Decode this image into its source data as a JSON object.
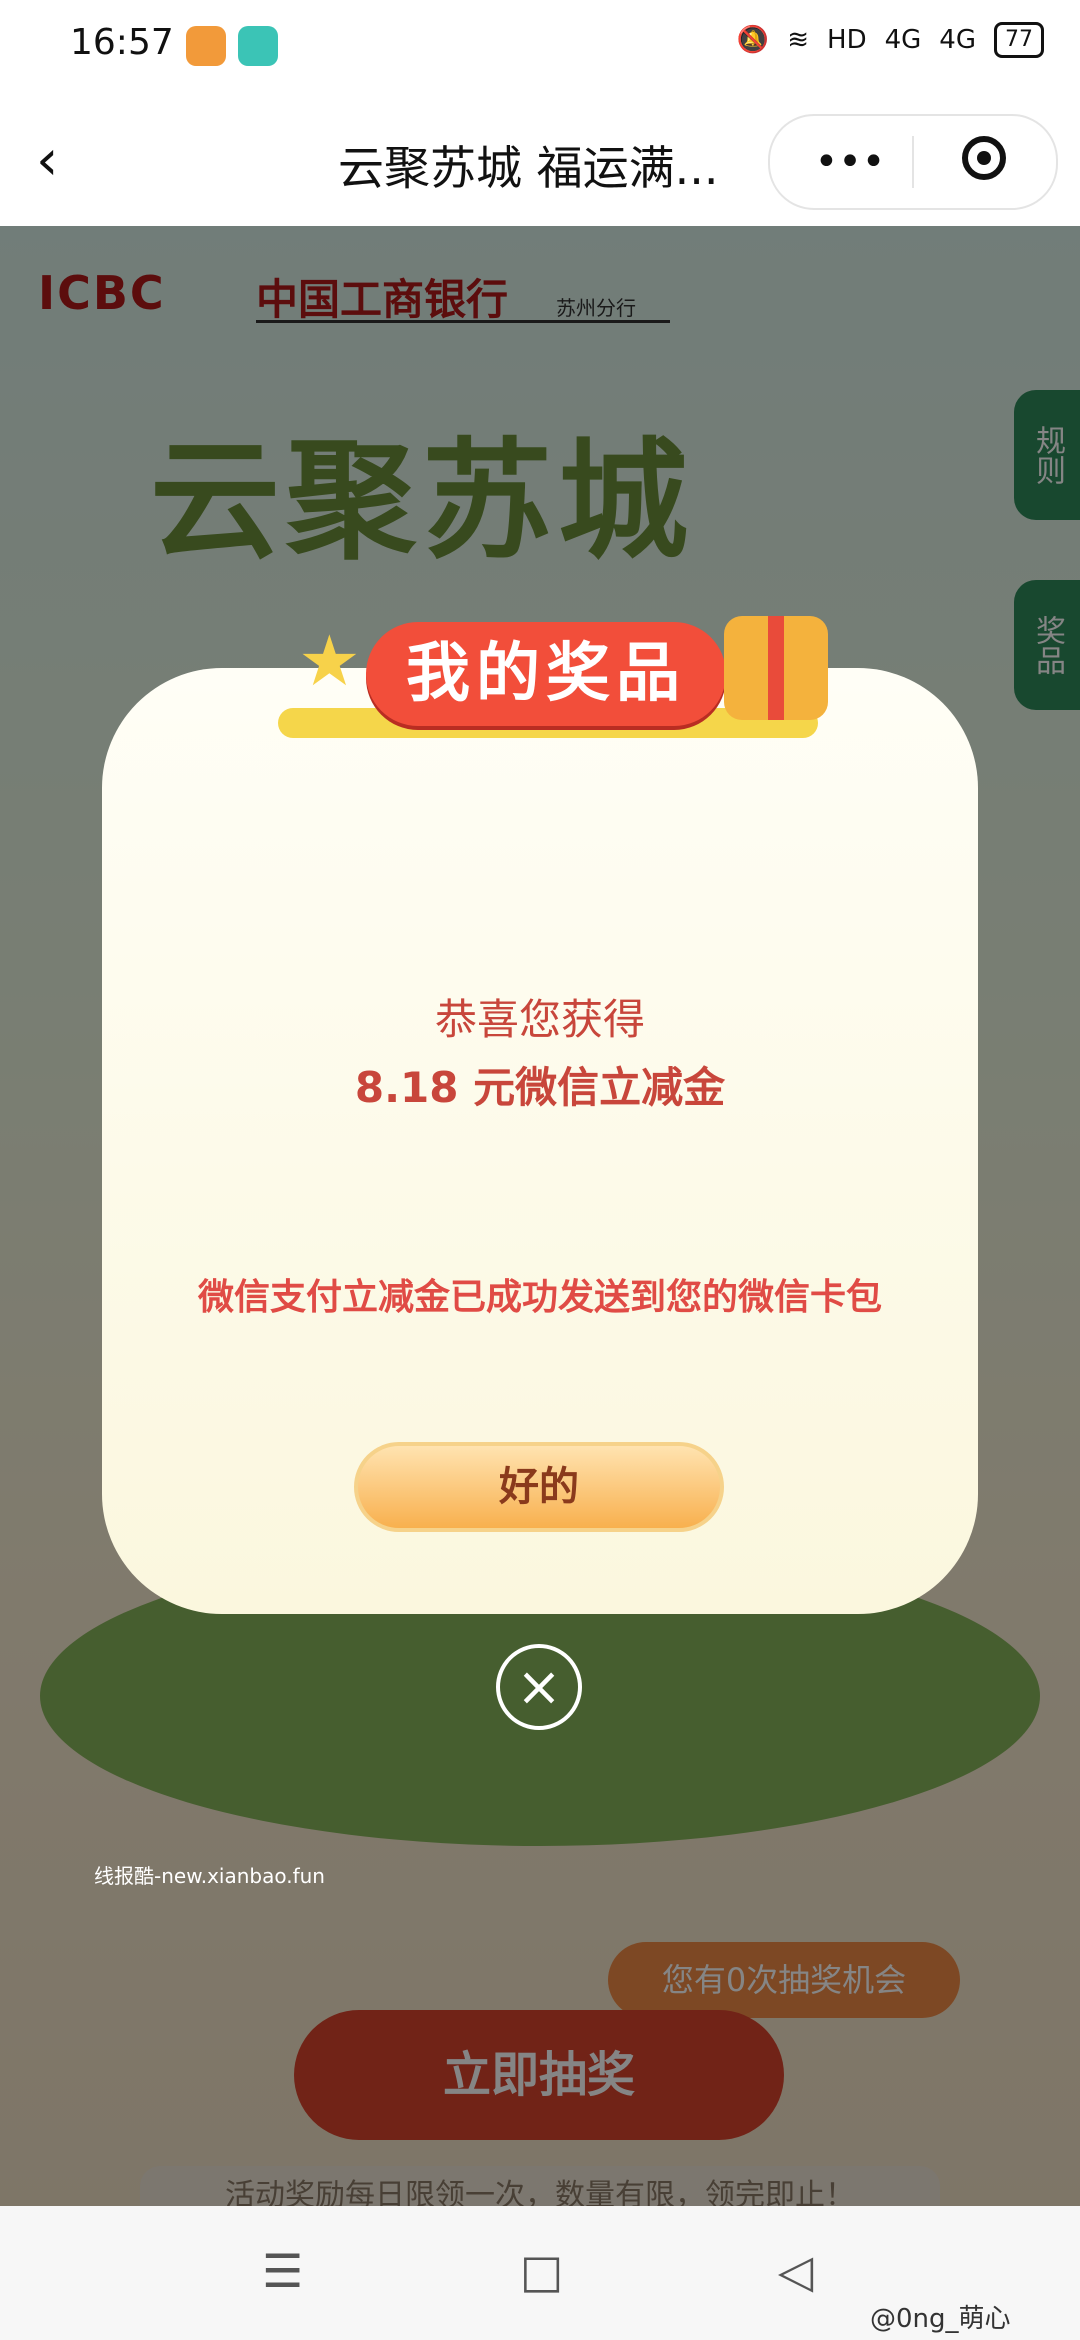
{
  "status_bar": {
    "time": "16:57",
    "network_hd": "HD",
    "signal_1": "4G",
    "signal_2": "4G",
    "battery": "77"
  },
  "title_bar": {
    "back_icon": "chevron-left-icon",
    "title": "云聚苏城 福运满...",
    "more_icon": "more-dots-icon",
    "close_icon": "target-close-icon"
  },
  "page": {
    "bank_logo": "ICBC",
    "bank_name": "中国工商银行",
    "bank_branch": "苏州分行",
    "hero_title": "云聚苏城",
    "side_tab_rules": "规则",
    "side_tab_prizes": "奖品",
    "chance_bubble": "您有0次抽奖机会",
    "draw_button": "立即抽奖",
    "footer_text": "活动奖励每日限领一次，数量有限，领完即止！",
    "watermark": "线报酷-new.xianbao.fun"
  },
  "modal": {
    "header_title": "我的奖品",
    "congrats": "恭喜您获得",
    "amount": "8.18 元微信立减金",
    "notice": "微信支付立减金已成功发送到您的微信卡包",
    "ok_button": "好的",
    "close_icon": "close-icon"
  },
  "nav_bar": {
    "menu_icon": "menu-icon",
    "home_icon": "square-home-icon",
    "back_icon": "triangle-back-icon"
  },
  "weibo_credit": "@0ng_萌心",
  "colors": {
    "modal_text": "#c8463b",
    "header_red": "#f24e3a",
    "button_orange": "#f8b04e",
    "draw_red": "#d9432c"
  }
}
